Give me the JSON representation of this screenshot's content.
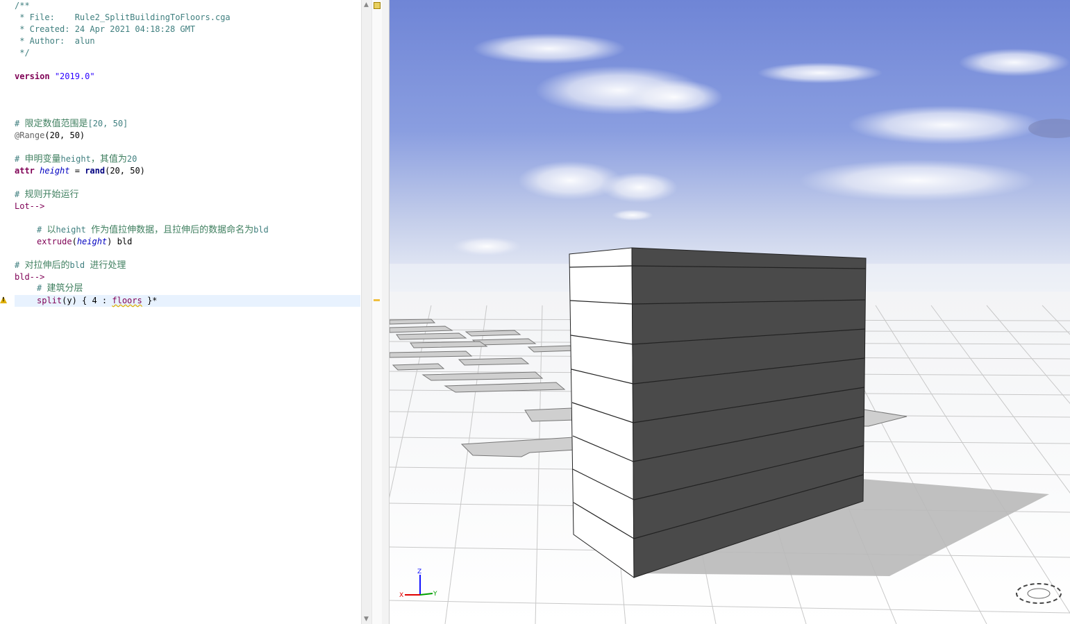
{
  "editor": {
    "header": {
      "l1": "/**",
      "l2": " * File:    Rule2_SplitBuildingToFloors.cga",
      "l3": " * Created: 24 Apr 2021 04:18:28 GMT",
      "l4": " * Author:  alun",
      "l5": " */"
    },
    "version_kw": "version",
    "version_val": "\"2019.0\"",
    "c1_hash": "# ",
    "c1_text": "限定数值范围是",
    "c1_range": "[20, 50]",
    "range_dec": "@Range",
    "range_args": "(20, 50)",
    "c2_hash": "# ",
    "c2_text1": "申明变量",
    "c2_var": "height",
    "c2_text2": "，其值为",
    "c2_num": "20",
    "attr_kw": "attr",
    "attr_name": "height",
    "attr_eq": " = ",
    "attr_fn": "rand",
    "attr_args": "(20, 50)",
    "c3_hash": "# ",
    "c3_text": "规则开始运行",
    "lot_rule": "Lot-->",
    "c4_hash": "# ",
    "c4_text1": "以",
    "c4_var": "height",
    "c4_text2": "作为值拉伸数据，且拉伸后的数据命名为",
    "c4_name": "bld",
    "extrude_fn": "extrude",
    "extrude_open": "(",
    "extrude_arg": "height",
    "extrude_rest": ") bld",
    "c5_hash": "# ",
    "c5_text1": "对拉伸后的",
    "c5_name": "bld",
    "c5_text2": "进行处理",
    "bld_rule": "bld-->",
    "c6_hash": "# ",
    "c6_text": "建筑分层",
    "split_fn": "split",
    "split_args": "(y) { 4 : ",
    "split_floors": "floors",
    "split_end": " }*"
  },
  "viewport": {
    "axis_z": "Z",
    "axis_x": "X",
    "axis_y": "Y",
    "colors": {
      "sky_top": "#6f85d6",
      "sky_bottom": "#e8edf5",
      "building_dark": "#4a4a4a",
      "building_light": "#ffffff",
      "ground": "#ffffff",
      "grid": "#c8c8c8",
      "shadow": "#b9b9b9"
    }
  }
}
